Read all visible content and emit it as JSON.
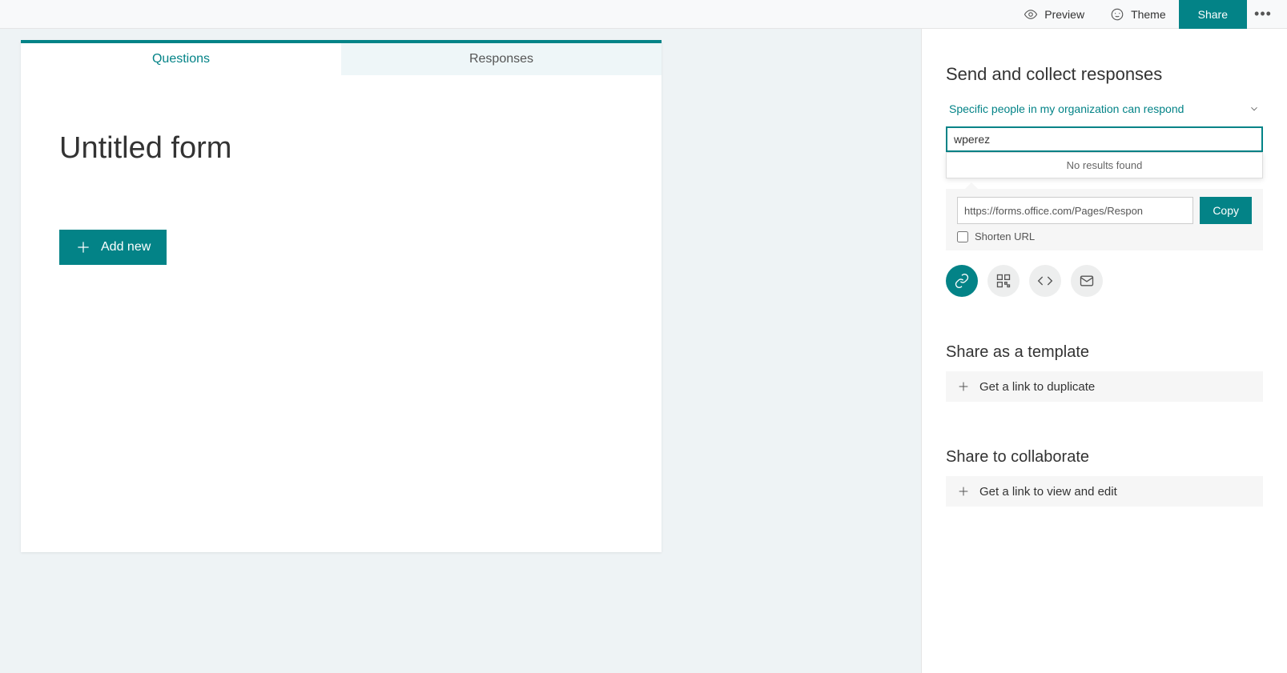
{
  "topbar": {
    "preview": "Preview",
    "theme": "Theme",
    "share": "Share"
  },
  "tabs": {
    "questions": "Questions",
    "responses": "Responses"
  },
  "form": {
    "title": "Untitled form",
    "add_new": "Add new"
  },
  "panel": {
    "heading": "Send and collect responses",
    "permission_label": "Specific people in my organization can respond",
    "search_value": "wperez",
    "no_results": "No results found",
    "share_url": "https://forms.office.com/Pages/Respon",
    "copy": "Copy",
    "shorten": "Shorten URL",
    "template_heading": "Share as a template",
    "template_link": "Get a link to duplicate",
    "collab_heading": "Share to collaborate",
    "collab_link": "Get a link to view and edit"
  }
}
